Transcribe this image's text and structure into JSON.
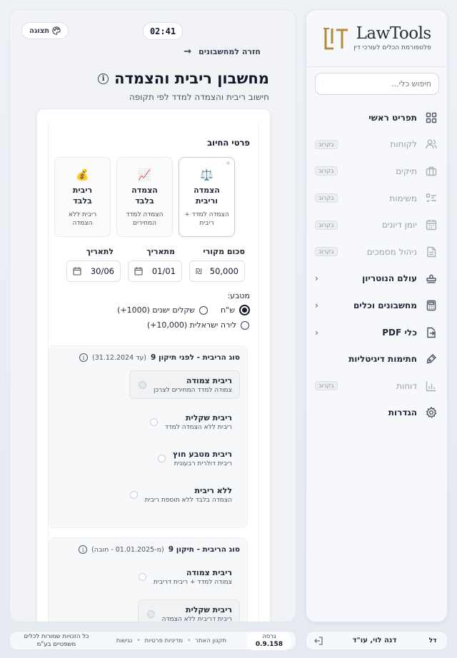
{
  "app": {
    "logo_name": "LawTools",
    "logo_tagline": "פלטפורמת הכלים לעורכי דין"
  },
  "search": {
    "placeholder": "חיפוש כלי..."
  },
  "nav": {
    "items": [
      {
        "label": "תפריט ראשי",
        "icon": "grid-icon",
        "disabled": false
      },
      {
        "label": "לקוחות",
        "icon": "users-icon",
        "badge": "בקרוב",
        "disabled": true
      },
      {
        "label": "תיקים",
        "icon": "briefcase-icon",
        "badge": "בקרוב",
        "disabled": true
      },
      {
        "label": "משימות",
        "icon": "tasks-icon",
        "badge": "בקרוב",
        "disabled": true
      },
      {
        "label": "יומן דיונים",
        "icon": "calendar-icon",
        "badge": "בקרוב",
        "disabled": true
      },
      {
        "label": "ניהול מסמכים",
        "icon": "document-icon",
        "badge": "בקרוב",
        "disabled": true
      },
      {
        "label": "עולם הנוטריון",
        "icon": "stamp-icon",
        "has_submenu": true,
        "disabled": false
      },
      {
        "label": "מחשבונים וכלים",
        "icon": "calculator-icon",
        "has_submenu": true,
        "disabled": false
      },
      {
        "label": "כלי PDF",
        "icon": "pdf-export-icon",
        "has_submenu": true,
        "disabled": false
      },
      {
        "label": "חתימות דיגיטליות",
        "icon": "signature-icon",
        "disabled": false
      },
      {
        "label": "דוחות",
        "icon": "bar-chart-icon",
        "badge": "בקרוב",
        "disabled": true
      },
      {
        "label": "הגדרות",
        "icon": "gear-icon",
        "disabled": false
      }
    ]
  },
  "user": {
    "initials": "דל",
    "name": "דנה לוי, עו\"ד"
  },
  "topbar": {
    "view_label": "תצוגה",
    "timer": "02:41"
  },
  "page": {
    "back_label": "חזרה למחשבונים",
    "title": "מחשבון ריבית והצמדה",
    "subtitle": "חישוב ריבית והצמדה למדד לפי תקופה"
  },
  "form": {
    "section_title": "פרטי החיוב",
    "calc_types": [
      {
        "title": "הצמדה וריבית",
        "desc": "הצמדה למדד + ריבית",
        "icon": "⚖️",
        "selected": true
      },
      {
        "title": "הצמדה בלבד",
        "desc": "הצמדה למדד המחירים",
        "icon": "📈",
        "selected": false
      },
      {
        "title": "ריבית בלבד",
        "desc": "ריבית ללא הצמדה",
        "icon": "💰",
        "selected": false
      }
    ],
    "labels": {
      "amount": "סכום מקורי",
      "from_date": "מתאריך",
      "to_date": "לתאריך"
    },
    "values": {
      "amount": "50,000",
      "currency_symbol": "₪",
      "from_date": "01/01",
      "to_date": "30/06"
    },
    "currency": {
      "label": "מטבע:",
      "options": [
        {
          "label": "ש\"ח",
          "checked": true
        },
        {
          "label": "שקלים ישנים (1000+)",
          "checked": false
        },
        {
          "label": "לירה ישראלית (10,000+)",
          "checked": false
        }
      ]
    },
    "interest_before": {
      "title": "סוג הריבית - לפני תיקון 9",
      "note": "(עד 31.12.2024)",
      "options": [
        {
          "title": "ריבית צמודה",
          "desc": "צמודה למדד המחירים לצרכן",
          "selected": true
        },
        {
          "title": "ריבית שקלית",
          "desc": "ריבית ללא הצמדה למדד",
          "selected": false
        },
        {
          "title": "ריבית מטבע חוץ",
          "desc": "ריבית דולרית רבעונית",
          "selected": false
        },
        {
          "title": "ללא ריבית",
          "desc": "הצמדה בלבד ללא תוספת ריבית",
          "selected": false
        }
      ]
    },
    "interest_after": {
      "title": "סוג הריבית - תיקון 9",
      "note": "(מ-01.01.2025 - חובה)",
      "options": [
        {
          "title": "ריבית צמודה",
          "desc": "צמודה למדד + ריבית דריבית",
          "selected": false
        },
        {
          "title": "ריבית שקלית",
          "desc": "ריבית דריבית ללא הצמדה",
          "selected": true
        }
      ]
    }
  },
  "footer": {
    "version_label": "גרסה",
    "version": "0.9.158",
    "links": [
      "תקנון האתר",
      "מדיניות פרטיות",
      "נגישות"
    ],
    "copyright": "כל הזכויות שמורות לכלים משפטיים בע\"מ"
  }
}
